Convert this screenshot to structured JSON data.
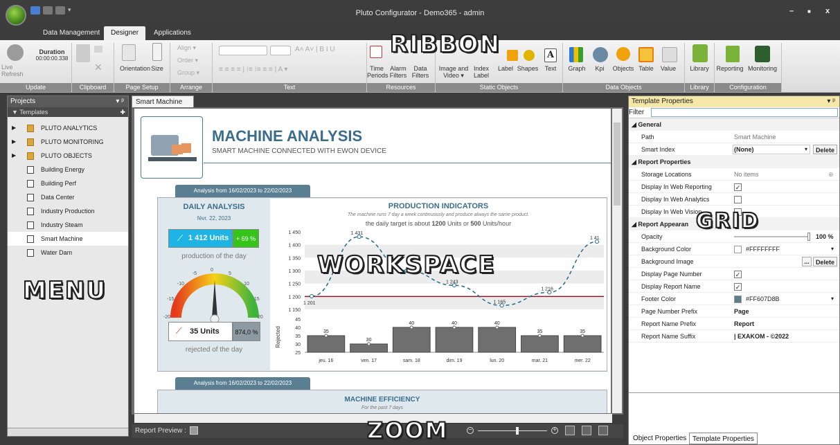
{
  "app": {
    "title": "Pluto Configurator - Demo365 - admin",
    "window_controls": [
      "–",
      "■",
      "x"
    ]
  },
  "ribbon_tabs": [
    "Data Management",
    "Designer",
    "Applications"
  ],
  "ribbon": {
    "update": {
      "live_refresh": "Live Refresh",
      "duration_label": "Duration",
      "duration_value": "00:00:00.338",
      "group": "Update"
    },
    "clipboard": {
      "group": "Clipboard"
    },
    "page_setup": {
      "orientation": "Orientation",
      "size": "Size",
      "group": "Page Setup"
    },
    "arrange": {
      "align": "Align ▾",
      "order": "Order ▾",
      "group_btn": "Group ▾",
      "group": "Arrange"
    },
    "text": {
      "group": "Text"
    },
    "resources": {
      "time_periods": "Time Periods",
      "alarm_filters": "Alarm Filters",
      "data_filters": "Data Filters",
      "group": "Resources"
    },
    "static_objects": {
      "image_video": "Image and Video ▾",
      "index_label": "Index Label",
      "label": "Label",
      "shapes": "Shapes",
      "text": "Text",
      "group": "Static Objects"
    },
    "data_objects": {
      "graph": "Graph",
      "kpi": "Kpi",
      "objects": "Objects",
      "table": "Table",
      "value": "Value",
      "group": "Data Objects"
    },
    "library": {
      "library": "Library",
      "group": "Library"
    },
    "configuration": {
      "reporting": "Reporting",
      "monitoring": "Monitoring",
      "group": "Configuration"
    }
  },
  "overlay_labels": {
    "ribbon": "RIBBON",
    "menu": "MENU",
    "workspace": "WORKSPACE",
    "grid": "GRID",
    "zoom": "ZOOM"
  },
  "projects": {
    "header": "Projects",
    "pin": "▾ ᵖ",
    "templates": "Templates",
    "items": [
      {
        "label": "PLUTO ANALYTICS",
        "type": "folder"
      },
      {
        "label": "PLUTO MONITORING",
        "type": "folder"
      },
      {
        "label": "PLUTO OBJECTS",
        "type": "folder"
      },
      {
        "label": "Building Energy",
        "type": "doc"
      },
      {
        "label": "Building Perf",
        "type": "doc"
      },
      {
        "label": "Data Center",
        "type": "doc"
      },
      {
        "label": "Industry Production",
        "type": "doc"
      },
      {
        "label": "Industry Steam",
        "type": "doc"
      },
      {
        "label": "Smart Machine",
        "type": "doc"
      },
      {
        "label": "Water Dam",
        "type": "doc"
      }
    ]
  },
  "workspace": {
    "tab": "Smart Machine",
    "report_preview": "Report Preview :",
    "zoom_value": 0.55,
    "page": {
      "title": "MACHINE ANALYSIS",
      "subtitle": "SMART MACHINE CONNECTED WITH EWON DEVICE",
      "period": "Analysis from 16/02/2023 to 22/02/2023",
      "daily": {
        "title": "DAILY ANALYSIS",
        "date": "févr. 22, 2023",
        "units": "1 412 Units",
        "pct": "+ 69 %",
        "prod_label": "production of the day",
        "rejected_units": "35 Units",
        "rejected_pct": "874,0 %",
        "rejected_label": "rejected of the day",
        "gauge_ticks": [
          "-20",
          "-15",
          "-10",
          "-5",
          "0",
          "5",
          "10",
          "15",
          "20"
        ]
      },
      "indicators": {
        "title": "PRODUCTION INDICATORS",
        "note": "The machine runs 7 day a week continuously and produce always the same product.",
        "target_pre": "the daily target is about ",
        "target_units": "1200",
        "target_mid": " Units or ",
        "target_rate": "500",
        "target_post": " Units/hour"
      },
      "period2": "Analysis from 16/02/2023 to 22/02/2023",
      "efficiency": {
        "title": "MACHINE EFFICIENCY",
        "sub": "For the past 7 days"
      }
    }
  },
  "chart_data": [
    {
      "type": "line",
      "categories": [
        "jeu. 16",
        "ven. 17",
        "sam. 18",
        "dim. 19",
        "lun. 20",
        "mar. 21",
        "mer. 22"
      ],
      "series": [
        {
          "values": [
            1201,
            1431,
            1300,
            1243,
            1165,
            1216,
            1412
          ]
        }
      ],
      "data_labels": [
        "1 201",
        "1 431",
        "",
        "1 243",
        "1 165",
        "1 216",
        "1 41"
      ],
      "target": 1200,
      "yticks": [
        "1 450",
        "1 400",
        "1 350",
        "1 300",
        "1 250",
        "1 200",
        "1 150"
      ],
      "ylim": [
        1150,
        1450
      ]
    },
    {
      "type": "bar",
      "categories": [
        "jeu. 16",
        "ven. 17",
        "sam. 18",
        "dim. 19",
        "lun. 20",
        "mar. 21",
        "mer. 22"
      ],
      "values": [
        35,
        30,
        40,
        40,
        40,
        35,
        35
      ],
      "ylabel": "Rejected",
      "yticks": [
        "45",
        "40",
        "35",
        "30",
        "25"
      ],
      "ylim": [
        25,
        45
      ]
    }
  ],
  "properties": {
    "header": "Template Properties",
    "filter": "Filter",
    "rows": [
      {
        "kind": "cat",
        "label": "General"
      },
      {
        "kind": "row",
        "k": "Path",
        "v": "Smart Machine",
        "style": "muted"
      },
      {
        "kind": "row",
        "k": "Smart Index",
        "v": "(None)",
        "style": "bold",
        "dropdown": true,
        "delete": "Delete"
      },
      {
        "kind": "cat",
        "label": "Report Properties"
      },
      {
        "kind": "row",
        "k": "Storage Locations",
        "v": "No items",
        "style": "muted"
      },
      {
        "kind": "row",
        "k": "Display In Web Reporting",
        "check": true
      },
      {
        "kind": "row",
        "k": "Display In Web Analytics",
        "check": false
      },
      {
        "kind": "row",
        "k": "Display In Web Vision",
        "check": false
      },
      {
        "kind": "cat",
        "label": "Report Appearan"
      },
      {
        "kind": "row",
        "k": "Opacity",
        "v": "100 %",
        "slider": true
      },
      {
        "kind": "row",
        "k": "Background Color",
        "v": "#FFFFFFFF",
        "swatch": "#FFFFFF"
      },
      {
        "kind": "row",
        "k": "Background Image",
        "v": "",
        "delete": "Delete",
        "ellipsis": "..."
      },
      {
        "kind": "row",
        "k": "Display Page Number",
        "check": true
      },
      {
        "kind": "row",
        "k": "Display Report Name",
        "check": true
      },
      {
        "kind": "row",
        "k": "Footer Color",
        "v": "#FF607D8B",
        "swatch": "#607D8B"
      },
      {
        "kind": "row",
        "k": "Page Number Prefix",
        "v": "Page",
        "style": "bold"
      },
      {
        "kind": "row",
        "k": "Report Name Prefix",
        "v": "Report",
        "style": "bold"
      },
      {
        "kind": "row",
        "k": "Report Name Suffix",
        "v": "| EXAKOM - ©2022",
        "style": "bold"
      }
    ],
    "bottom_tabs": [
      "Object Properties",
      "Template Properties"
    ]
  },
  "colors": {
    "accent_teal": "#5a7f93",
    "kpi_cyan": "#1eb5e6",
    "kpi_green": "#35c41a",
    "target_line": "#8b1a2b",
    "curve": "#1f6b8a"
  }
}
